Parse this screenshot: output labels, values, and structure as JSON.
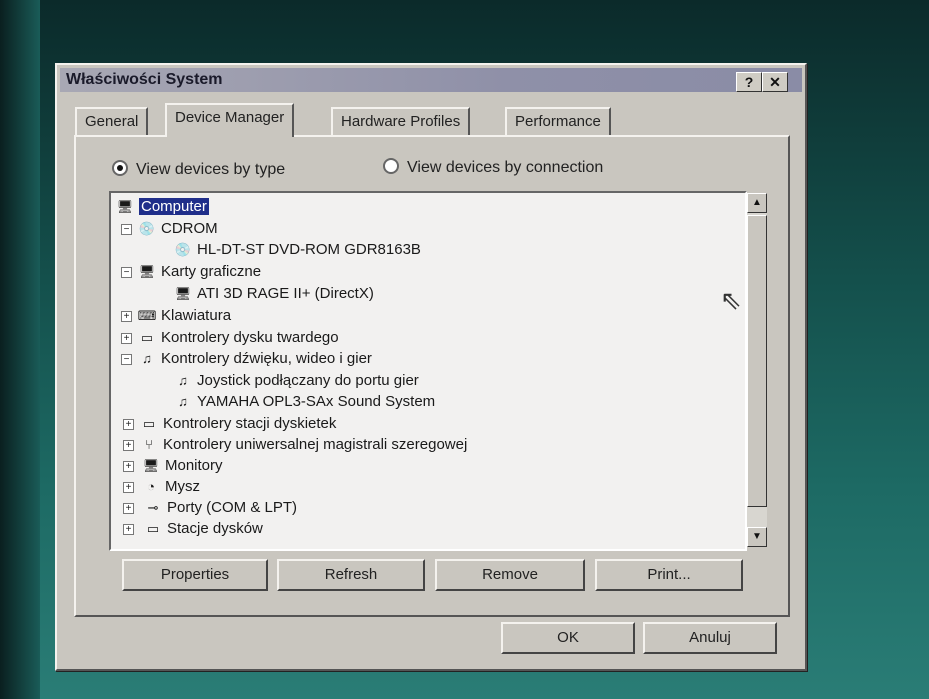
{
  "window": {
    "title": "Właściwości System",
    "help_btn": "?",
    "close_btn": "✕"
  },
  "tabs": [
    {
      "label": "General"
    },
    {
      "label": "Device Manager"
    },
    {
      "label": "Hardware Profiles"
    },
    {
      "label": "Performance"
    }
  ],
  "view_options": {
    "by_type": "View devices by type",
    "by_connection": "View devices by connection"
  },
  "tree": [
    {
      "label": "Computer",
      "icon": "computer-icon"
    },
    {
      "label": "CDROM",
      "icon": "cdrom-icon"
    },
    {
      "label": "HL-DT-ST DVD-ROM GDR8163B",
      "icon": "cdrom-icon"
    },
    {
      "label": "Karty graficzne",
      "icon": "display-icon"
    },
    {
      "label": "ATI 3D RAGE II+ (DirectX)",
      "icon": "display-icon"
    },
    {
      "label": "Klawiatura",
      "icon": "keyboard-icon"
    },
    {
      "label": "Kontrolery dysku twardego",
      "icon": "disk-controller-icon"
    },
    {
      "label": "Kontrolery dźwięku, wideo i gier",
      "icon": "sound-icon"
    },
    {
      "label": "Joystick podłączany do portu gier",
      "icon": "sound-icon"
    },
    {
      "label": "YAMAHA OPL3-SAx Sound System",
      "icon": "sound-icon"
    },
    {
      "label": "Kontrolery stacji dyskietek",
      "icon": "floppy-controller-icon"
    },
    {
      "label": "Kontrolery uniwersalnej magistrali szeregowej",
      "icon": "usb-icon"
    },
    {
      "label": "Monitory",
      "icon": "monitor-icon"
    },
    {
      "label": "Mysz",
      "icon": "mouse-icon"
    },
    {
      "label": "Porty (COM & LPT)",
      "icon": "port-icon"
    },
    {
      "label": "Stacje dysków",
      "icon": "drive-icon"
    }
  ],
  "buttons": {
    "properties": "Properties",
    "refresh": "Refresh",
    "remove": "Remove",
    "print": "Print...",
    "ok": "OK",
    "cancel": "Anuluj"
  }
}
